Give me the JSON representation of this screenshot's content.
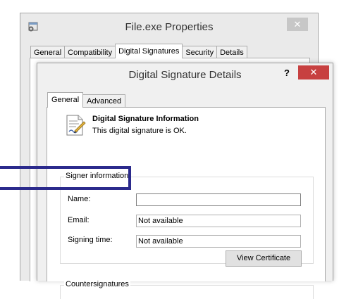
{
  "outer_window": {
    "title": "File.exe Properties",
    "close_symbol": "✕",
    "tabs": [
      "General",
      "Compatibility",
      "Digital Signatures",
      "Security",
      "Details"
    ],
    "active_tab": "Digital Signatures"
  },
  "dialog": {
    "title": "Digital Signature Details",
    "help_symbol": "?",
    "close_symbol": "✕",
    "close_color": "#c74040",
    "tabs": [
      "General",
      "Advanced"
    ],
    "active_tab": "General",
    "info": {
      "icon": "certificate-document-icon",
      "heading": "Digital Signature Information",
      "status": "This digital signature is OK."
    },
    "signer_group_label": "Signer information",
    "fields": {
      "name_label": "Name:",
      "name_value": "",
      "email_label": "Email:",
      "email_value": "Not available",
      "signing_time_label": "Signing time:",
      "signing_time_value": "Not available"
    },
    "view_certificate_label": "View Certificate",
    "countersignatures_label": "Countersignatures"
  },
  "annotation": {
    "highlight_color": "#2b2a8c"
  }
}
